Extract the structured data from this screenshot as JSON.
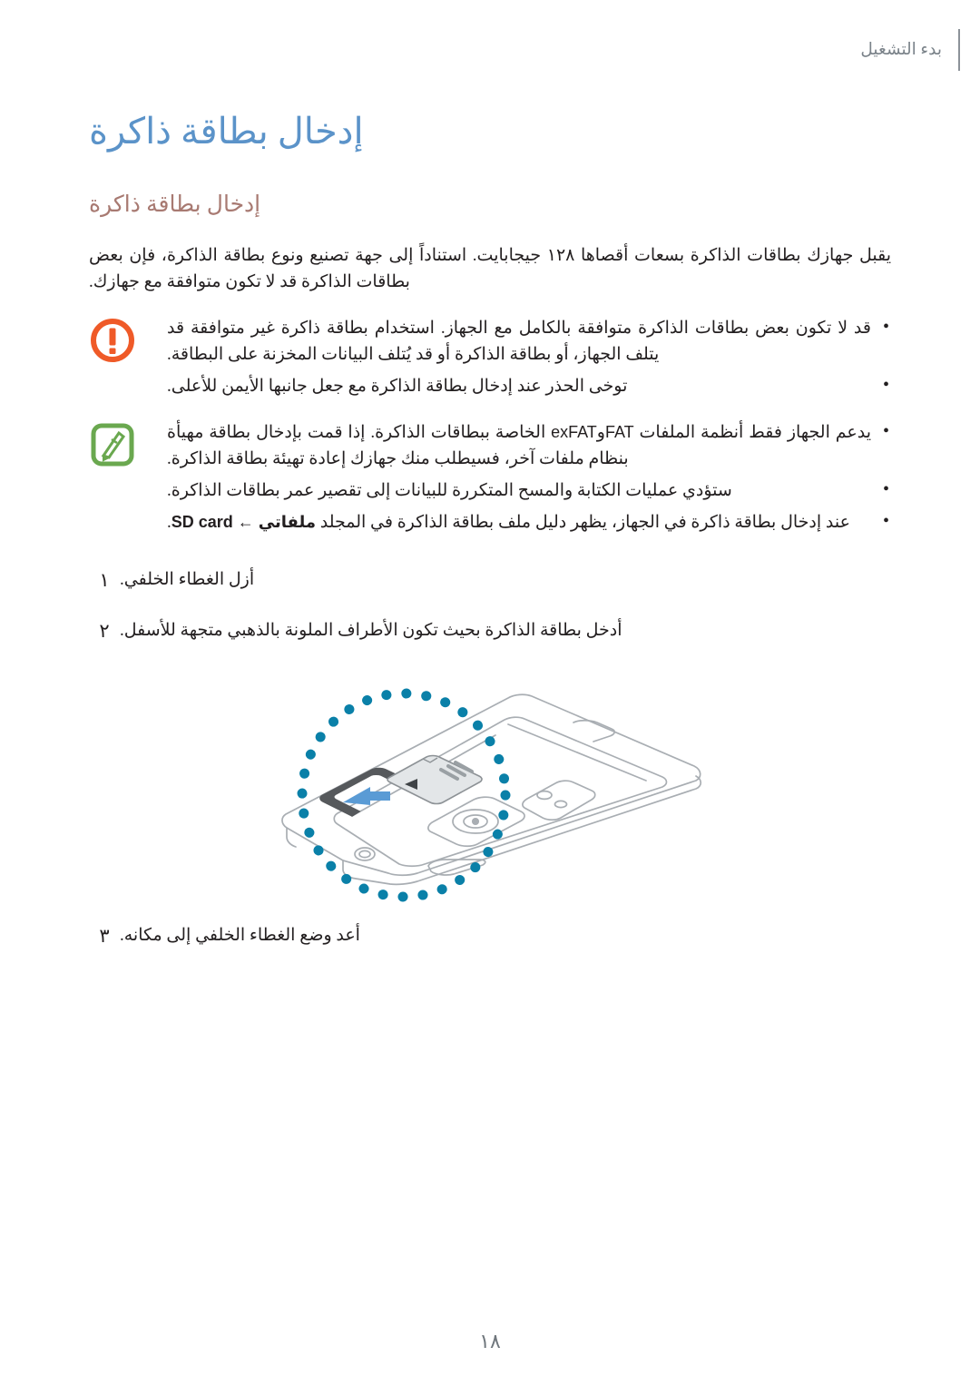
{
  "header": {
    "running_head": "بدء التشغيل"
  },
  "chapter": {
    "title": "إدخال بطاقة ذاكرة"
  },
  "section": {
    "title": "إدخال بطاقة ذاكرة",
    "intro": "يقبل جهازك بطاقات الذاكرة بسعات أقصاها ١٢٨ جيجابايت. استناداً إلى جهة تصنيع ونوع بطاقة الذاكرة، فإن بعض بطاقات الذاكرة قد لا تكون متوافقة مع جهازك."
  },
  "caution": {
    "icon": "warning-exclamation-icon",
    "icon_color": "#ef5a28",
    "items": [
      "قد لا تكون بعض بطاقات الذاكرة متوافقة بالكامل مع الجهاز. استخدام بطاقة ذاكرة غير متوافقة قد يتلف الجهاز، أو بطاقة الذاكرة أو قد يُتلف البيانات المخزنة على البطاقة.",
      "توخى الحذر عند إدخال بطاقة الذاكرة مع جعل جانبها الأيمن للأعلى."
    ]
  },
  "note": {
    "icon": "note-pencil-icon",
    "icon_color": "#6aa84f",
    "items": [
      {
        "prefix": "يدعم الجهاز فقط أنظمة الملفات ",
        "latin1": "FAT",
        "mid1": "و",
        "latin2": "exFAT",
        "suffix": " الخاصة ببطاقات الذاكرة. إذا قمت بإدخال بطاقة مهيأة بنظام ملفات آخر، فسيطلب منك جهازك إعادة تهيئة بطاقة الذاكرة."
      },
      {
        "plain": "ستؤدي عمليات الكتابة والمسح المتكررة للبيانات إلى تقصير عمر بطاقات الذاكرة."
      },
      {
        "prefix": "عند إدخال بطاقة ذاكرة في الجهاز، يظهر دليل ملف بطاقة الذاكرة في المجلد ",
        "bold_path": "ملفاتي ← SD card",
        "suffix": "."
      }
    ]
  },
  "steps": [
    {
      "number": "١",
      "text": "أزل الغطاء الخلفي."
    },
    {
      "number": "٢",
      "text": "أدخل بطاقة الذاكرة بحيث تكون الأطراف الملونة بالذهبي متجهة للأسفل."
    },
    {
      "number": "٣",
      "text": "أعد وضع الغطاء الخلفي إلى مكانه."
    }
  ],
  "figure": {
    "name": "phone-back-memory-card-slot-illustration",
    "highlight_color": "#0a80a8",
    "arrow_color": "#4a8fd0",
    "line_color": "#a7acb1"
  },
  "folio": {
    "page_number": "١٨"
  }
}
